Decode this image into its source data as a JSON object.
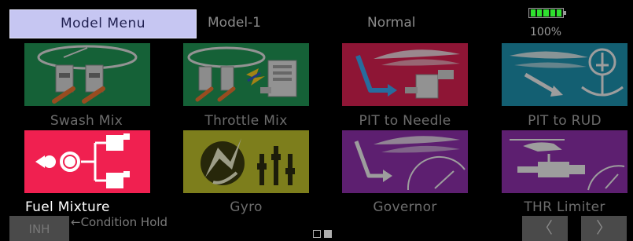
{
  "header": {
    "menu_title": "Model Menu",
    "model_name": "Model-1",
    "condition_name": "Normal",
    "battery_percent": "100%",
    "battery_level": 1.0,
    "battery_color": "#2fe12f"
  },
  "tiles": [
    {
      "label": "Swash Mix",
      "icon": "swash-mix-icon",
      "color": "#1f8f52",
      "selected": false
    },
    {
      "label": "Throttle Mix",
      "icon": "throttle-mix-icon",
      "color": "#1f8f52",
      "selected": false
    },
    {
      "label": "PIT to Needle",
      "icon": "pit-to-needle-icon",
      "color": "#d21f4f",
      "selected": false
    },
    {
      "label": "PIT to RUD",
      "icon": "pit-to-rud-icon",
      "color": "#1d8ca8",
      "selected": false
    },
    {
      "label": "Fuel Mixture",
      "icon": "fuel-mixture-icon",
      "color": "#f02050",
      "selected": true
    },
    {
      "label": "Gyro",
      "icon": "gyro-icon",
      "color": "#b8ba2a",
      "selected": false
    },
    {
      "label": "Governor",
      "icon": "governor-icon",
      "color": "#8a2fa6",
      "selected": false
    },
    {
      "label": "THR Limiter",
      "icon": "thr-limiter-icon",
      "color": "#8a2fa6",
      "selected": false
    }
  ],
  "footer": {
    "inh_label": "INH",
    "condition_hold_label": "←Condition Hold",
    "prev_label": "〈",
    "next_label": "〉",
    "page_current": 2,
    "page_total": 2
  }
}
